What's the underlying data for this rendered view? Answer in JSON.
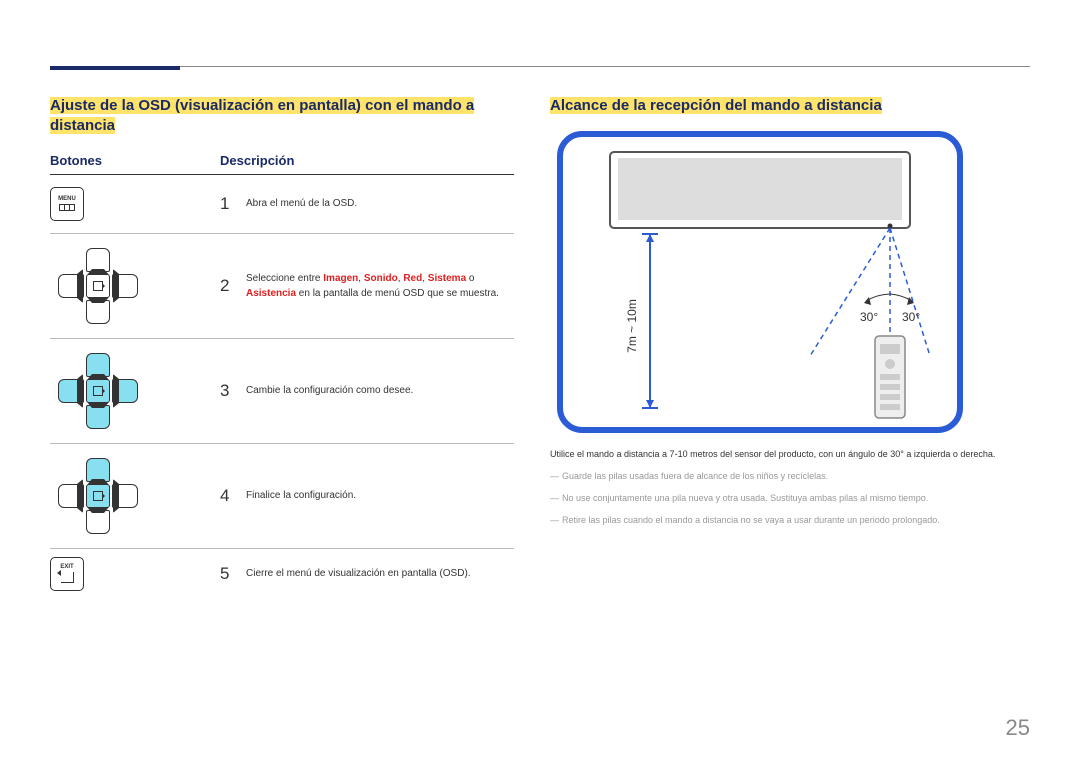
{
  "page_number": "25",
  "left": {
    "title": "Ajuste de la OSD (visualización en pantalla) con el mando a distancia",
    "header_buttons": "Botones",
    "header_desc": "Descripción",
    "menu_label": "MENU",
    "exit_label": "EXIT",
    "rows": [
      {
        "num": "1",
        "desc_plain": "Abra el menú de la OSD."
      },
      {
        "num": "2",
        "desc_prefix": "Seleccione entre ",
        "red1": "Imagen",
        "sep1": ", ",
        "red2": "Sonido",
        "sep2": ", ",
        "red3": "Red",
        "sep3": ", ",
        "red4": "Sistema",
        "mid": " o ",
        "red5": "Asistencia",
        "suffix": " en la pantalla de menú OSD que se muestra."
      },
      {
        "num": "3",
        "desc_plain": "Cambie la configuración como desee."
      },
      {
        "num": "4",
        "desc_plain": "Finalice la configuración."
      },
      {
        "num": "5",
        "desc_plain": "Cierre el menú de visualización en pantalla (OSD)."
      }
    ]
  },
  "right": {
    "title": "Alcance de la recepción del mando a distancia",
    "range_label": "7m ~ 10m",
    "angle_left": "30°",
    "angle_right": "30°",
    "body": "Utilice el mando a distancia a 7-10 metros del sensor del producto, con un ángulo de 30° a izquierda o derecha.",
    "notes": [
      "Guarde las pilas usadas fuera de alcance de los niños y recíclelas.",
      "No use conjuntamente una pila nueva y otra usada. Sustituya ambas pilas al mismo tiempo.",
      "Retire las pilas cuando el mando a distancia no se vaya a usar durante un periodo prolongado."
    ]
  }
}
